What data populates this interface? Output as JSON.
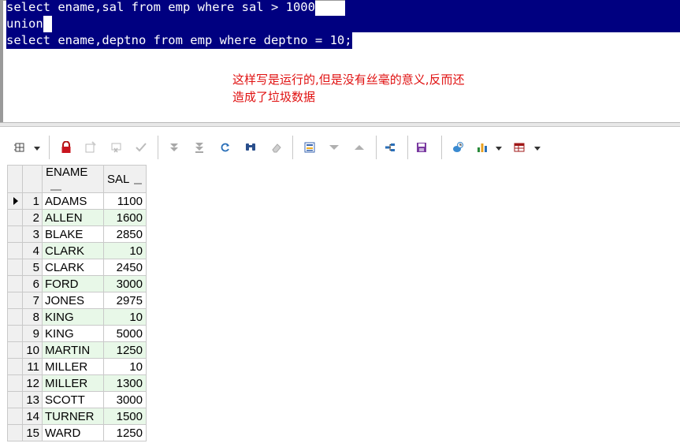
{
  "editor": {
    "lines": [
      "select ename,sal from emp where sal > 1000",
      "union",
      "select ename,deptno from emp where deptno = 10;"
    ],
    "note_line1": "这样写是运行的,但是没有丝毫的意义,反而还",
    "note_line2": "造成了垃圾数据"
  },
  "grid": {
    "columns": [
      "ENAME",
      "SAL"
    ],
    "rows": [
      {
        "n": "1",
        "ename": "ADAMS",
        "sal": "1100"
      },
      {
        "n": "2",
        "ename": "ALLEN",
        "sal": "1600"
      },
      {
        "n": "3",
        "ename": "BLAKE",
        "sal": "2850"
      },
      {
        "n": "4",
        "ename": "CLARK",
        "sal": "10"
      },
      {
        "n": "5",
        "ename": "CLARK",
        "sal": "2450"
      },
      {
        "n": "6",
        "ename": "FORD",
        "sal": "3000"
      },
      {
        "n": "7",
        "ename": "JONES",
        "sal": "2975"
      },
      {
        "n": "8",
        "ename": "KING",
        "sal": "10"
      },
      {
        "n": "9",
        "ename": "KING",
        "sal": "5000"
      },
      {
        "n": "10",
        "ename": "MARTIN",
        "sal": "1250"
      },
      {
        "n": "11",
        "ename": "MILLER",
        "sal": "10"
      },
      {
        "n": "12",
        "ename": "MILLER",
        "sal": "1300"
      },
      {
        "n": "13",
        "ename": "SCOTT",
        "sal": "3000"
      },
      {
        "n": "14",
        "ename": "TURNER",
        "sal": "1500"
      },
      {
        "n": "15",
        "ename": "WARD",
        "sal": "1250"
      }
    ]
  },
  "colors": {
    "selection": "#000080",
    "note": "#e01010",
    "alt_row": "#e8f8e8"
  },
  "icons": [
    "grid-options-icon",
    "lock-icon",
    "new-record-icon",
    "delete-record-icon",
    "post-changes-icon",
    "fetch-next-icon",
    "fetch-all-icon",
    "refresh-icon",
    "find-icon",
    "clear-icon",
    "query-by-example-icon",
    "previous-record-icon",
    "next-record-icon",
    "export-icon",
    "save-icon",
    "link-icon",
    "chart-icon",
    "single-record-view-icon"
  ]
}
